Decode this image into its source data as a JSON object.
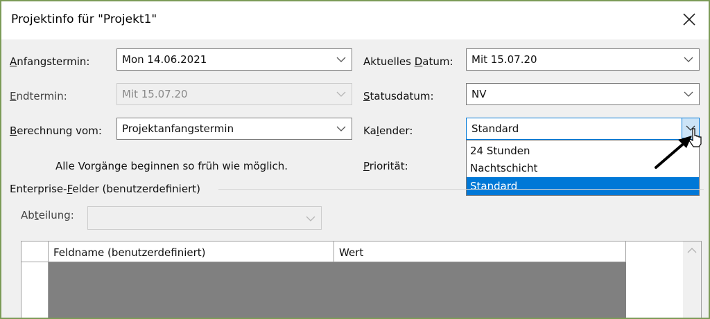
{
  "dialog": {
    "title": "Projektinfo für \"Projekt1\""
  },
  "icons": {
    "close": "close-icon",
    "chevron": "chevron-down-icon",
    "cursor": "pointer-cursor-icon",
    "arrow": "annotation-arrow-icon"
  },
  "fields": {
    "anfangstermin": {
      "label_u": "A",
      "label_rest": "nfangstermin:",
      "value": "Mon 14.06.2021"
    },
    "endtermin": {
      "label_u": "E",
      "label_rest": "ndtermin:",
      "value": "Mit 15.07.20",
      "disabled": true
    },
    "berechnung": {
      "label_u": "B",
      "label_rest": "erechnung vom:",
      "value": "Projektanfangstermin"
    },
    "aktuelles_datum": {
      "label_pre": "Aktuelles ",
      "label_u": "D",
      "label_rest": "atum:",
      "value": "Mit 15.07.20"
    },
    "statusdatum": {
      "label_u": "S",
      "label_rest": "tatusdatum:",
      "value": "NV"
    },
    "kalender": {
      "label_pre": "Ka",
      "label_u": "l",
      "label_rest": "ender:",
      "value": "Standard"
    },
    "prioritaet": {
      "label_u": "P",
      "label_rest": "riorität:"
    }
  },
  "info_text": "Alle Vorgänge beginnen so früh wie möglich.",
  "calendar_options": [
    {
      "label": "24 Stunden",
      "selected": false
    },
    {
      "label": "Nachtschicht",
      "selected": false
    },
    {
      "label": "Standard",
      "selected": true
    }
  ],
  "enterprise": {
    "section_pre": "Enterprise-",
    "section_u": "F",
    "section_rest": "elder (benutzerdefiniert)",
    "abteilung_pre": "Ab",
    "abteilung_u": "t",
    "abteilung_rest": "eilung:",
    "abteilung_value": "",
    "grid_columns": [
      "Feldname (benutzerdefiniert)",
      "Wert"
    ]
  },
  "colors": {
    "frame_border": "#7b9b57",
    "accent": "#0078d7",
    "grid_body": "#808080"
  }
}
